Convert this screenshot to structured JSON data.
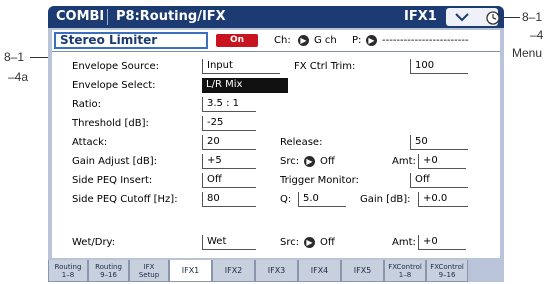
{
  "callouts": {
    "left_a": "8–1",
    "left_b": "–4a",
    "right_a": "8–1",
    "right_b": "–4",
    "right_c": "Menu"
  },
  "header": {
    "mode": "COMBI",
    "page_title": "P8:Routing/IFX",
    "tab_title": "IFX1",
    "menu_icon": "chevron-down-icon",
    "clock_icon": "clock-icon"
  },
  "effect": {
    "name": "Stereo Limiter",
    "on_label": "On",
    "ch_label": "Ch:",
    "ch_value": "G ch",
    "p_label": "P:",
    "p_value": "------------------------"
  },
  "params": {
    "envelope_source": {
      "label": "Envelope Source:",
      "value": "Input"
    },
    "fx_ctrl_trim": {
      "label": "FX Ctrl Trim:",
      "value": "100"
    },
    "envelope_select": {
      "label": "Envelope Select:",
      "value": "L/R Mix"
    },
    "ratio": {
      "label": "Ratio:",
      "value": "3.5 : 1"
    },
    "threshold": {
      "label": "Threshold [dB]:",
      "value": "-25"
    },
    "attack": {
      "label": "Attack:",
      "value": "20"
    },
    "release": {
      "label": "Release:",
      "value": "50"
    },
    "gain_adjust": {
      "label": "Gain Adjust [dB]:",
      "value": "+5"
    },
    "src1": {
      "label": "Src:",
      "value": "Off"
    },
    "amt1": {
      "label": "Amt:",
      "value": "+0"
    },
    "side_peq_insert": {
      "label": "Side PEQ Insert:",
      "value": "Off"
    },
    "trigger_monitor": {
      "label": "Trigger Monitor:",
      "value": "Off"
    },
    "side_peq_cutoff": {
      "label": "Side PEQ Cutoff [Hz]:",
      "value": "80"
    },
    "q": {
      "label": "Q:",
      "value": "5.0"
    },
    "gain_db": {
      "label": "Gain [dB]:",
      "value": "+0.0"
    },
    "wet_dry": {
      "label": "Wet/Dry:",
      "value": "Wet"
    },
    "src2": {
      "label": "Src:",
      "value": "Off"
    },
    "amt2": {
      "label": "Amt:",
      "value": "+0"
    }
  },
  "tabs": [
    {
      "line1": "Routing",
      "line2": "1–8"
    },
    {
      "line1": "Routing",
      "line2": "9–16"
    },
    {
      "line1": "IFX",
      "line2": "Setup"
    },
    {
      "line1": "IFX1",
      "line2": ""
    },
    {
      "line1": "IFX2",
      "line2": ""
    },
    {
      "line1": "IFX3",
      "line2": ""
    },
    {
      "line1": "IFX4",
      "line2": ""
    },
    {
      "line1": "IFX5",
      "line2": ""
    },
    {
      "line1": "FXControl",
      "line2": "1–8"
    },
    {
      "line1": "FXControl",
      "line2": "9–16"
    }
  ],
  "active_tab": "IFX1",
  "colors": {
    "title_bar": "#1c3b73",
    "on_button": "#c8141e",
    "panel_bg": "#b9c4d8"
  }
}
